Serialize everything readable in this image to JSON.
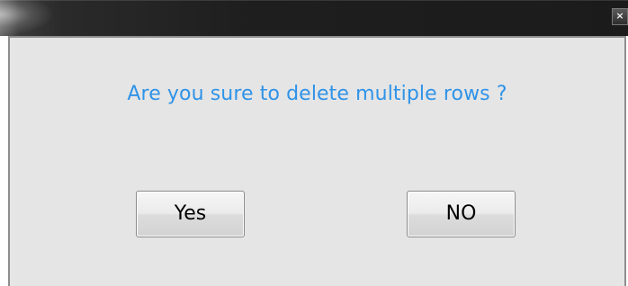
{
  "dialog": {
    "close_glyph": "×",
    "message": "Are you sure to delete multiple rows ?",
    "yes_label": "Yes",
    "no_label": "NO"
  },
  "colors": {
    "message_text": "#2f93e8",
    "panel_background": "#e5e5e5",
    "titlebar": "#1e1e1e"
  }
}
